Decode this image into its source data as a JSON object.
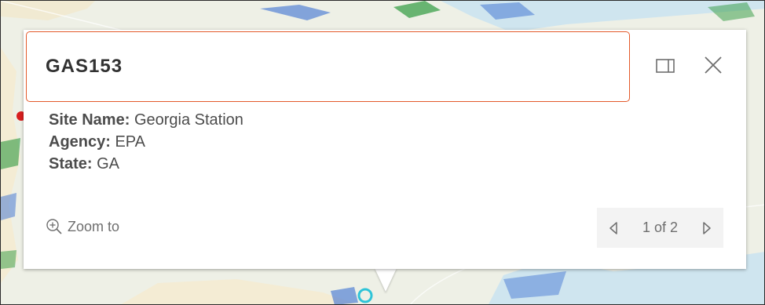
{
  "popup": {
    "title": "GAS153",
    "fields": [
      {
        "label": "Site Name:",
        "value": "Georgia Station"
      },
      {
        "label": "Agency:",
        "value": "EPA"
      },
      {
        "label": "State:",
        "value": "GA"
      }
    ],
    "zoom_label": "Zoom to",
    "pagination": "1 of 2",
    "icons": {
      "dock": "dock-icon",
      "close": "close-icon",
      "zoom": "zoom-in-icon",
      "prev": "chevron-left-icon",
      "next": "chevron-right-icon"
    }
  },
  "colors": {
    "header_border": "#e45a2b",
    "map_land": "#eef0e6",
    "map_water": "#cfe5ef",
    "marker": "#2ec4d8"
  }
}
